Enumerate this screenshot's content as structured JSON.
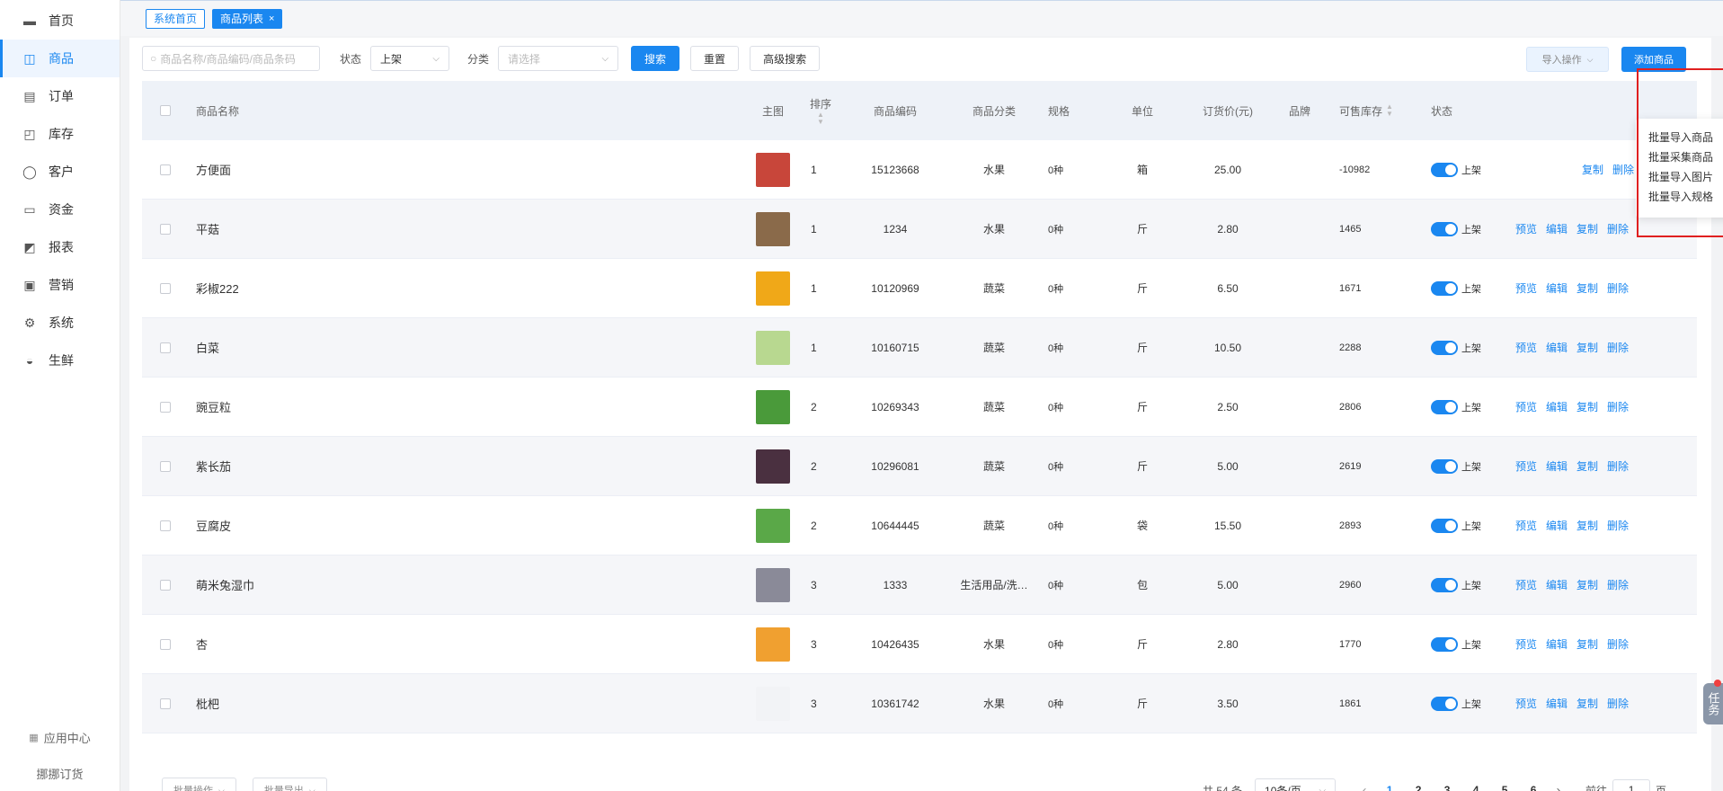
{
  "sidebar": {
    "items": [
      {
        "label": "首页",
        "icon": "home-icon"
      },
      {
        "label": "商品",
        "icon": "bag-icon"
      },
      {
        "label": "订单",
        "icon": "document-icon"
      },
      {
        "label": "库存",
        "icon": "box-icon"
      },
      {
        "label": "客户",
        "icon": "user-icon"
      },
      {
        "label": "资金",
        "icon": "wallet-icon"
      },
      {
        "label": "报表",
        "icon": "chart-icon"
      },
      {
        "label": "营销",
        "icon": "gift-icon"
      },
      {
        "label": "系统",
        "icon": "gear-icon"
      },
      {
        "label": "生鲜",
        "icon": "basket-icon"
      }
    ],
    "app_center": "应用中心",
    "brand": "挪挪订货"
  },
  "tags": {
    "home": "系统首页",
    "current": "商品列表",
    "close": "×"
  },
  "toolbar": {
    "search_placeholder": "商品名称/商品编码/商品条码",
    "status_label": "状态",
    "status_value": "上架",
    "category_label": "分类",
    "category_placeholder": "请选择",
    "search_button": "搜索",
    "reset_button": "重置",
    "advanced_button": "高级搜索",
    "import_button": "导入操作",
    "add_button": "添加商品"
  },
  "dropdown": {
    "items": [
      "批量导入商品",
      "批量采集商品",
      "批量导入图片",
      "批量导入规格"
    ]
  },
  "table": {
    "headers": {
      "name": "商品名称",
      "image": "主图",
      "sort": "排序",
      "code": "商品编码",
      "category": "商品分类",
      "spec": "规格",
      "unit": "单位",
      "price": "订货价(元)",
      "brand": "品牌",
      "stock": "可售库存",
      "status": "状态"
    },
    "rows": [
      {
        "name": "方便面",
        "sort": "1",
        "code": "15123668",
        "category": "水果",
        "spec": "0种",
        "unit": "箱",
        "price": "25.00",
        "stock": "-10982",
        "status": "上架",
        "thumb": "#c8463a"
      },
      {
        "name": "平菇",
        "sort": "1",
        "code": "1234",
        "category": "水果",
        "spec": "0种",
        "unit": "斤",
        "price": "2.80",
        "stock": "1465",
        "status": "上架",
        "thumb": "#8a6a4a"
      },
      {
        "name": "彩椒222",
        "sort": "1",
        "code": "10120969",
        "category": "蔬菜",
        "spec": "0种",
        "unit": "斤",
        "price": "6.50",
        "stock": "1671",
        "status": "上架",
        "thumb": "#f0a818"
      },
      {
        "name": "白菜",
        "sort": "1",
        "code": "10160715",
        "category": "蔬菜",
        "spec": "0种",
        "unit": "斤",
        "price": "10.50",
        "stock": "2288",
        "status": "上架",
        "thumb": "#b8d890"
      },
      {
        "name": "豌豆粒",
        "sort": "2",
        "code": "10269343",
        "category": "蔬菜",
        "spec": "0种",
        "unit": "斤",
        "price": "2.50",
        "stock": "2806",
        "status": "上架",
        "thumb": "#4a9a3a"
      },
      {
        "name": "紫长茄",
        "sort": "2",
        "code": "10296081",
        "category": "蔬菜",
        "spec": "0种",
        "unit": "斤",
        "price": "5.00",
        "stock": "2619",
        "status": "上架",
        "thumb": "#4a3040"
      },
      {
        "name": "豆腐皮",
        "sort": "2",
        "code": "10644445",
        "category": "蔬菜",
        "spec": "0种",
        "unit": "袋",
        "price": "15.50",
        "stock": "2893",
        "status": "上架",
        "thumb": "#5aa848"
      },
      {
        "name": "萌米兔湿巾",
        "sort": "3",
        "code": "1333",
        "category": "生活用品/洗…",
        "spec": "0种",
        "unit": "包",
        "price": "5.00",
        "stock": "2960",
        "status": "上架",
        "thumb": "#8a8a98"
      },
      {
        "name": "杏",
        "sort": "3",
        "code": "10426435",
        "category": "水果",
        "spec": "0种",
        "unit": "斤",
        "price": "2.80",
        "stock": "1770",
        "status": "上架",
        "thumb": "#f0a030"
      },
      {
        "name": "枇杷",
        "sort": "3",
        "code": "10361742",
        "category": "水果",
        "spec": "0种",
        "unit": "斤",
        "price": "3.50",
        "stock": "1861",
        "status": "上架",
        "thumb": "#f2f3f6"
      }
    ],
    "ops": {
      "preview": "预览",
      "edit": "编辑",
      "copy": "复制",
      "delete": "删除"
    },
    "first_row_ops": {
      "copy": "复制",
      "delete": "删除"
    }
  },
  "footer": {
    "batch_ops": "批量操作",
    "batch_export": "批量导出",
    "total": "共 54 条",
    "page_size": "10条/页",
    "pages": [
      "1",
      "2",
      "3",
      "4",
      "5",
      "6"
    ],
    "prev": "‹",
    "next": "›",
    "goto_label": "前往",
    "goto_value": "1",
    "page_unit": "页"
  },
  "task_tab": "任务",
  "colors": {
    "accent": "#1a87f0",
    "highlight": "#e02020"
  }
}
